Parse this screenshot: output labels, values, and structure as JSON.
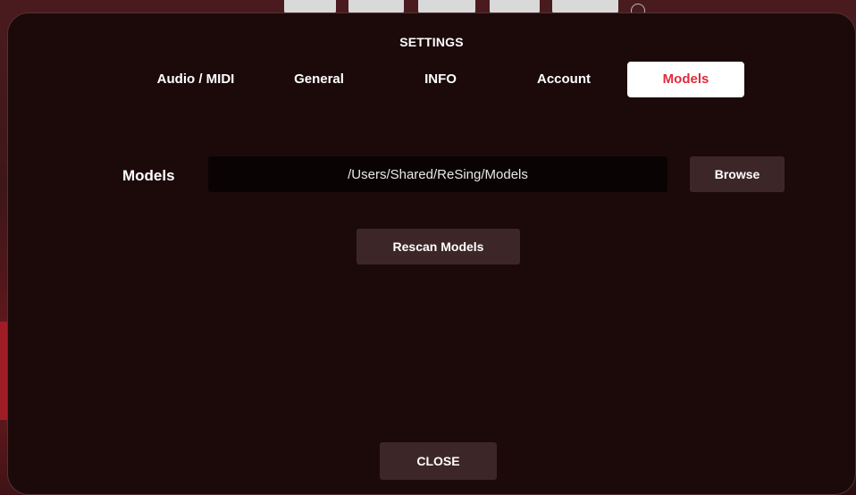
{
  "modal": {
    "title": "SETTINGS"
  },
  "tabs": [
    {
      "label": "Audio / MIDI",
      "active": false
    },
    {
      "label": "General",
      "active": false
    },
    {
      "label": "INFO",
      "active": false
    },
    {
      "label": "Account",
      "active": false
    },
    {
      "label": "Models",
      "active": true
    }
  ],
  "models_panel": {
    "label": "Models",
    "path_value": "/Users/Shared/ReSing/Models",
    "browse_label": "Browse",
    "rescan_label": "Rescan Models"
  },
  "footer": {
    "close_label": "CLOSE"
  },
  "colors": {
    "modal_bg": "#1c0a0b",
    "active_tab_bg": "#ffffff",
    "active_tab_text": "#e02a3d",
    "button_bg": "#3d2628"
  }
}
